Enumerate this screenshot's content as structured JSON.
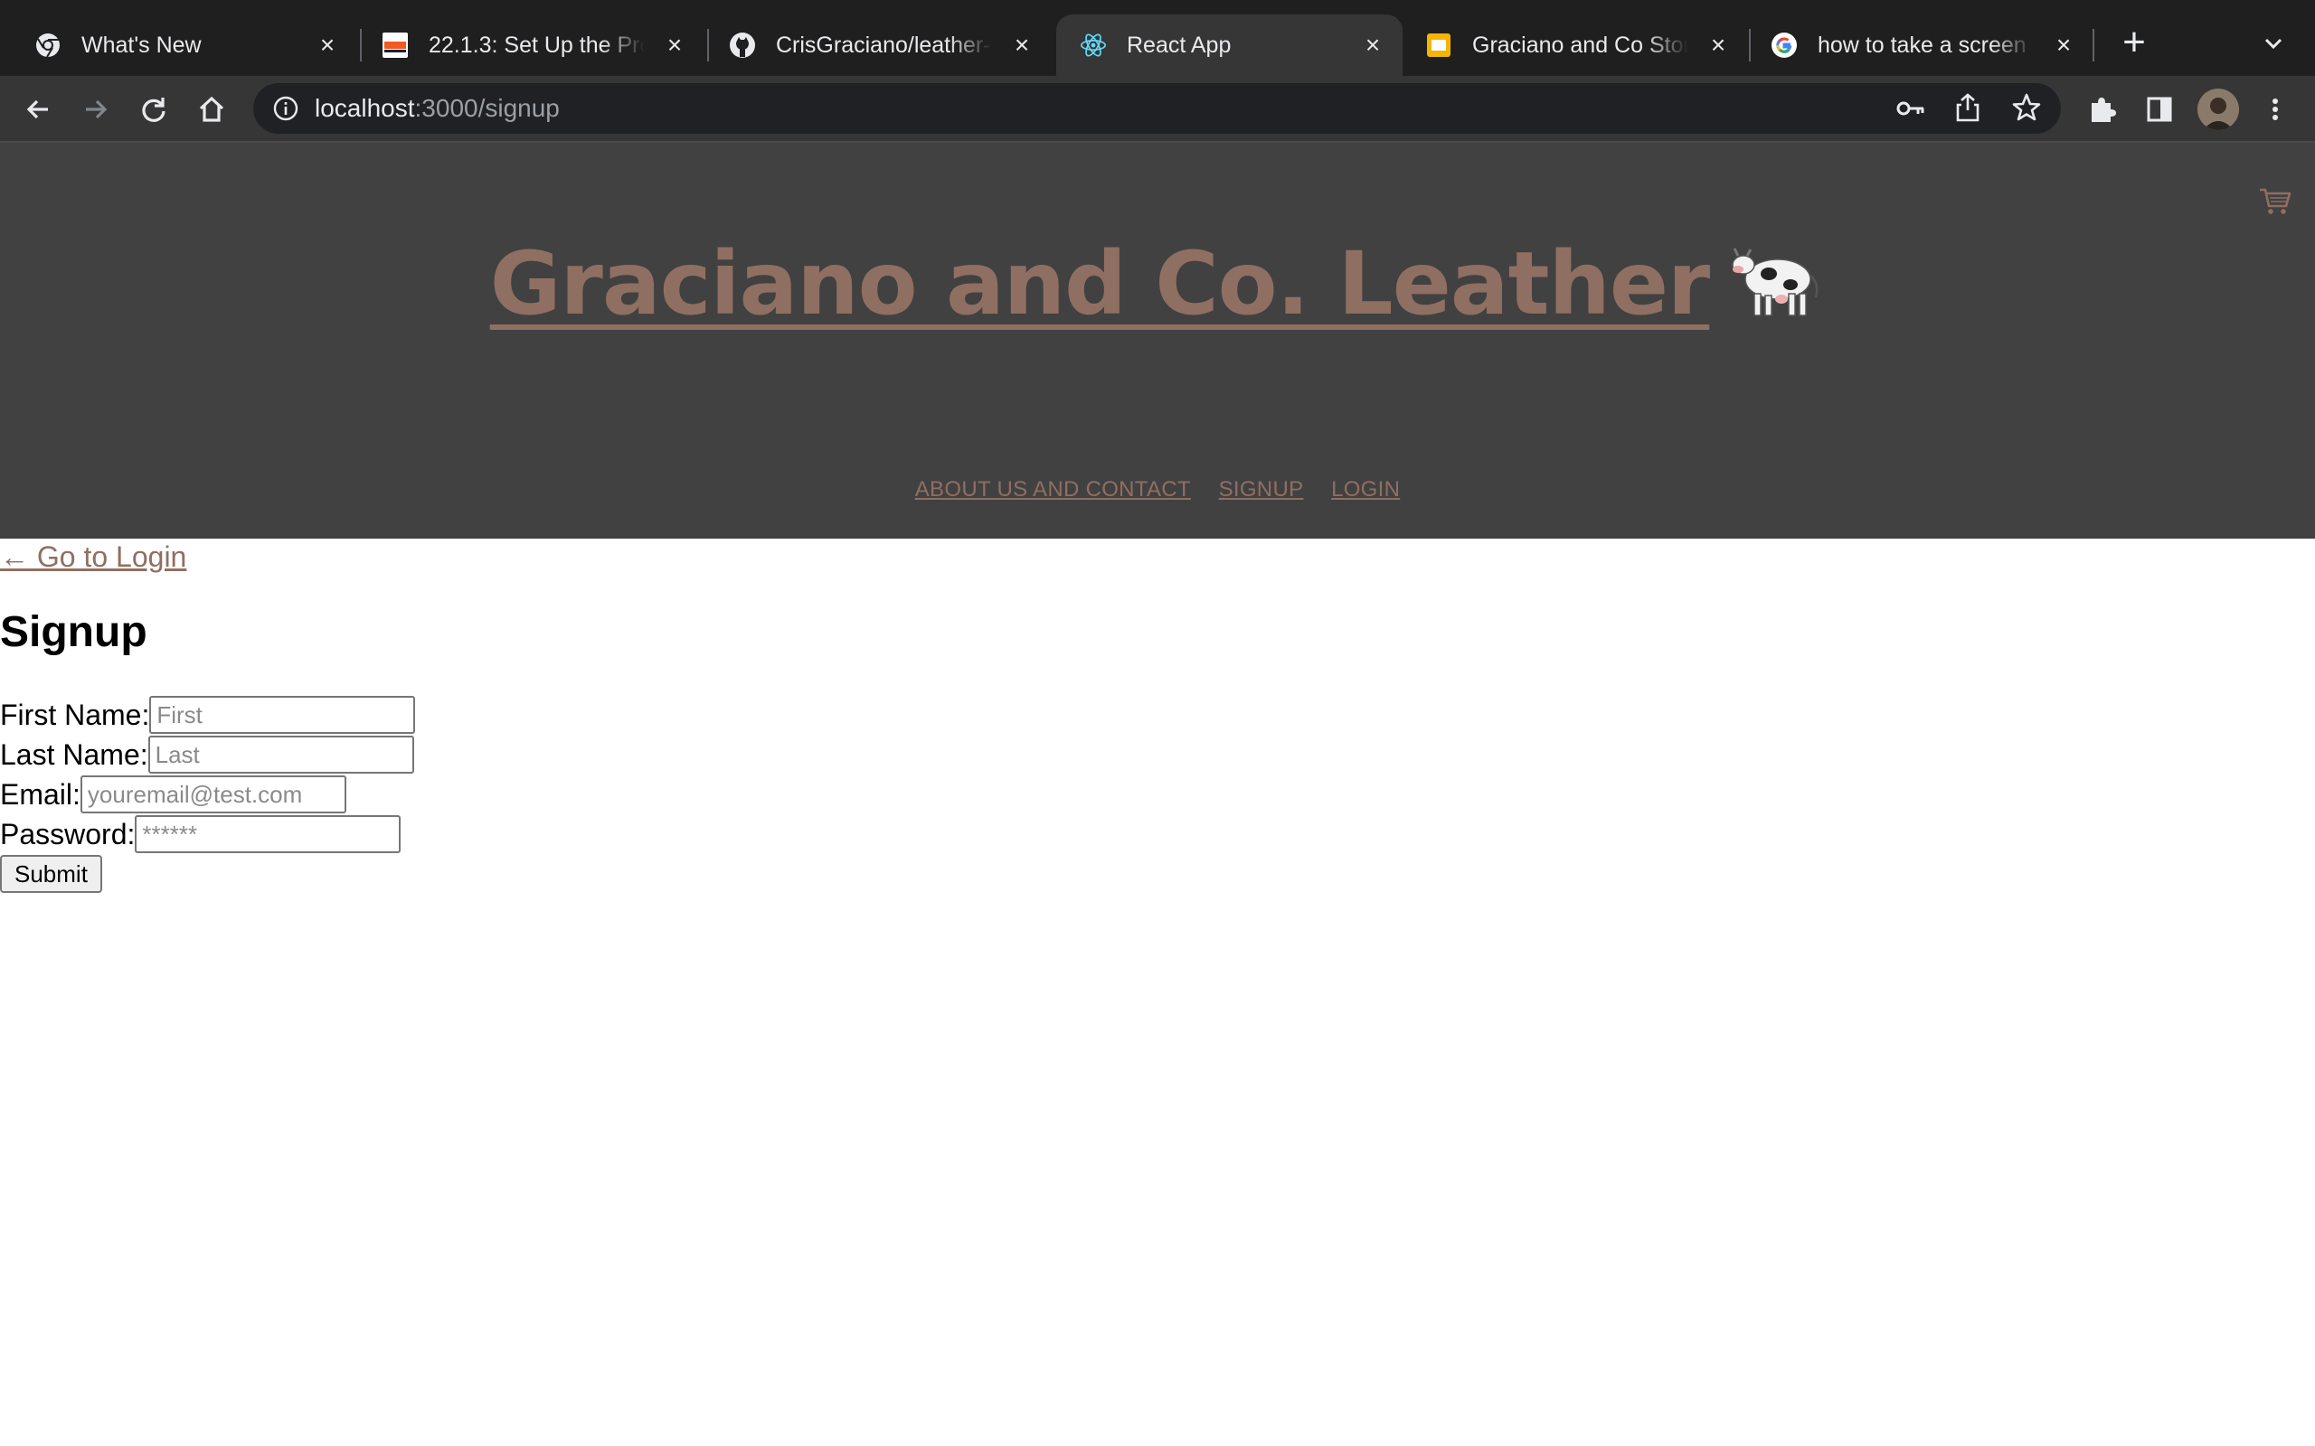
{
  "browser": {
    "tabs": [
      {
        "title": "What's New",
        "favicon": "chrome-icon",
        "active": false
      },
      {
        "title": "22.1.3: Set Up the Project",
        "favicon": "utsa-icon",
        "active": false
      },
      {
        "title": "CrisGraciano/leather-and-co",
        "favicon": "github-icon",
        "active": false
      },
      {
        "title": "React App",
        "favicon": "react-icon",
        "active": true
      },
      {
        "title": "Graciano and Co Store",
        "favicon": "slides-icon",
        "active": false
      },
      {
        "title": "how to take a screen print",
        "favicon": "google-icon",
        "active": false
      }
    ],
    "url_host": "localhost",
    "url_rest": ":3000/signup"
  },
  "site": {
    "title": "Graciano and Co. Leather",
    "title_icon": "cow-icon",
    "cart_icon": "shopping-cart-icon",
    "nav": [
      "ABOUT US AND CONTACT",
      "SIGNUP",
      "LOGIN"
    ]
  },
  "page": {
    "back_link": "← Go to Login",
    "heading": "Signup",
    "fields": [
      {
        "label": "First Name:",
        "placeholder": "First"
      },
      {
        "label": "Last Name:",
        "placeholder": "Last"
      },
      {
        "label": "Email:",
        "placeholder": "youremail@test.com"
      },
      {
        "label": "Password:",
        "placeholder": "******"
      }
    ],
    "submit_label": "Submit"
  },
  "colors": {
    "header_bg": "#414141",
    "accent_link": "#8f6f62",
    "tabbar_bg": "#1f1f1f",
    "toolbar_bg": "#363636"
  }
}
